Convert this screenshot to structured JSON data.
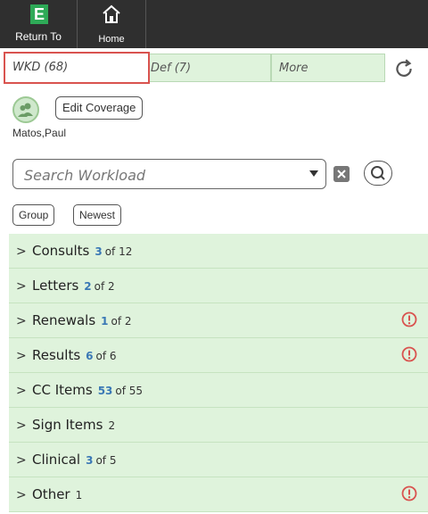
{
  "toolbar": {
    "return_label": "Return To",
    "return_logo": "E",
    "home_label": "Home"
  },
  "tabs": [
    {
      "label": "WKD (68)"
    },
    {
      "label": "Def (7)"
    },
    {
      "label": "More"
    }
  ],
  "coverage": {
    "edit_label": "Edit Coverage",
    "user_name": "Matos,Paul"
  },
  "search": {
    "placeholder": "Search Workload"
  },
  "filters": {
    "group_label": "Group",
    "newest_label": "Newest"
  },
  "workload": [
    {
      "name": "Consults",
      "count": "3",
      "of": "of 12",
      "alert": false
    },
    {
      "name": "Letters",
      "count": "2",
      "of": "of 2",
      "alert": false
    },
    {
      "name": "Renewals",
      "count": "1",
      "of": "of 2",
      "alert": true
    },
    {
      "name": "Results",
      "count": "6",
      "of": "of 6",
      "alert": true
    },
    {
      "name": "CC Items",
      "count": "53",
      "of": "of 55",
      "alert": false
    },
    {
      "name": "Sign Items",
      "count": "",
      "of": "2",
      "alert": false
    },
    {
      "name": "Clinical",
      "count": "3",
      "of": "of 5",
      "alert": false
    },
    {
      "name": "Other",
      "count": "",
      "of": "1",
      "alert": true
    }
  ],
  "colors": {
    "row_bg": "#dff3dc",
    "count_blue": "#3a78b5",
    "alert_red": "#d9534f",
    "highlight_border": "#d9534f"
  }
}
